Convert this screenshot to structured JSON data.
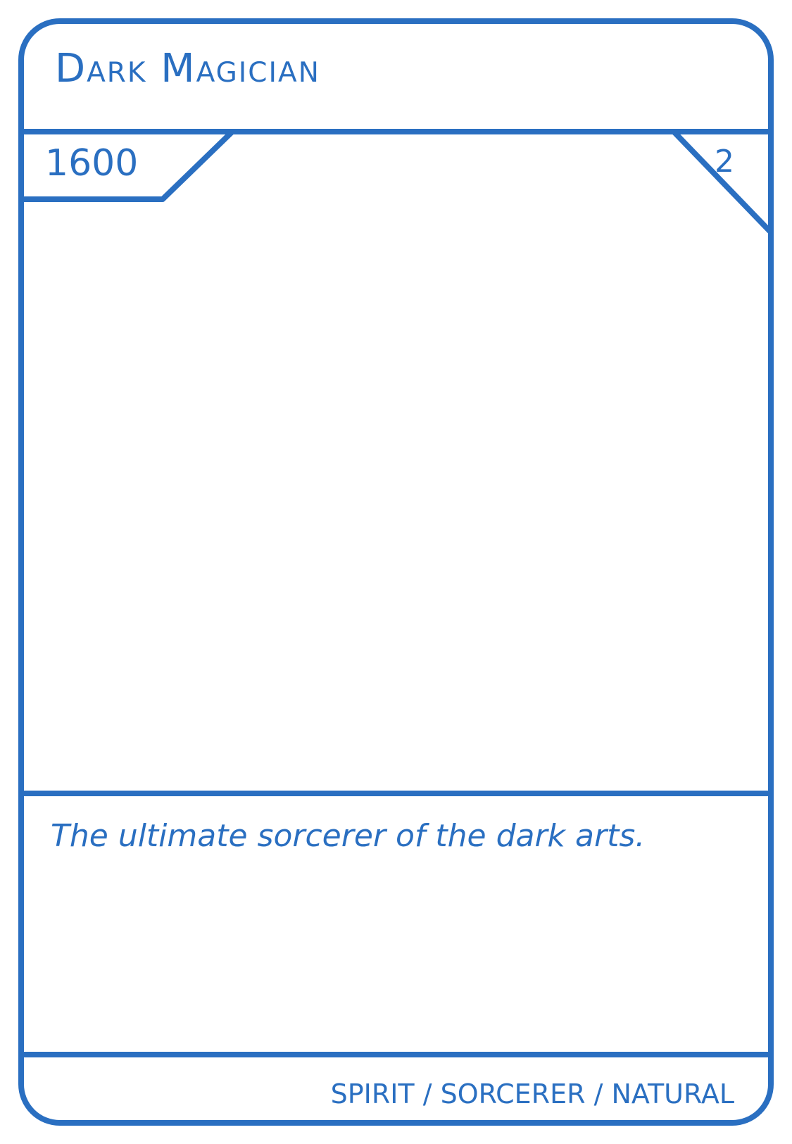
{
  "card": {
    "name": "Dark Magician",
    "power": "1600",
    "level": "2",
    "flavor_text": "The ultimate sorcerer of the dark arts.",
    "types": "SPIRIT / SORCERER / NATURAL"
  },
  "colors": {
    "accent": "#2a6fc1",
    "background": "#ffffff"
  }
}
